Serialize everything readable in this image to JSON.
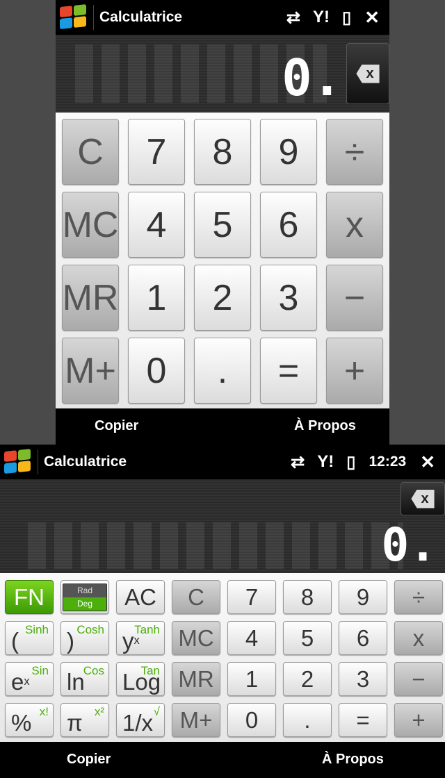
{
  "app_title": "Calculatrice",
  "clock": "12:23",
  "display_value": "0.",
  "backspace_label": "x",
  "menu": {
    "left": "Copier",
    "right": "À Propos"
  },
  "accent": "#4cae0c",
  "basic_keys": [
    {
      "l": "C",
      "t": "g"
    },
    {
      "l": "7"
    },
    {
      "l": "8"
    },
    {
      "l": "9"
    },
    {
      "l": "÷",
      "t": "g"
    },
    {
      "l": "MC",
      "t": "g"
    },
    {
      "l": "4"
    },
    {
      "l": "5"
    },
    {
      "l": "6"
    },
    {
      "l": "x",
      "t": "g"
    },
    {
      "l": "MR",
      "t": "g"
    },
    {
      "l": "1"
    },
    {
      "l": "2"
    },
    {
      "l": "3"
    },
    {
      "l": "−",
      "t": "g"
    },
    {
      "l": "M+",
      "t": "g"
    },
    {
      "l": "0"
    },
    {
      "l": "."
    },
    {
      "l": "="
    },
    {
      "l": "+",
      "t": "g"
    }
  ],
  "sci_keys": [
    {
      "l": "FN",
      "t": "fn"
    },
    {
      "l": "",
      "t": "rd",
      "rad": "Rad",
      "deg": "Deg"
    },
    {
      "l": "AC"
    },
    {
      "l": "C",
      "t": "g"
    },
    {
      "l": "7"
    },
    {
      "l": "8"
    },
    {
      "l": "9"
    },
    {
      "l": "÷",
      "t": "g"
    },
    {
      "l": "(",
      "s": "Sinh"
    },
    {
      "l": ")",
      "s": "Cosh"
    },
    {
      "l": "y",
      "p": "x",
      "s": "Tanh"
    },
    {
      "l": "MC",
      "t": "g"
    },
    {
      "l": "4"
    },
    {
      "l": "5"
    },
    {
      "l": "6"
    },
    {
      "l": "x",
      "t": "g"
    },
    {
      "l": "e",
      "p": "x",
      "s": "Sin"
    },
    {
      "l": "ln",
      "s": "Cos"
    },
    {
      "l": "Log",
      "s": "Tan"
    },
    {
      "l": "MR",
      "t": "g"
    },
    {
      "l": "1"
    },
    {
      "l": "2"
    },
    {
      "l": "3"
    },
    {
      "l": "−",
      "t": "g"
    },
    {
      "l": "%",
      "s": "x!"
    },
    {
      "l": "π",
      "s": "x²"
    },
    {
      "l": "1/x",
      "s": "√"
    },
    {
      "l": "M+",
      "t": "g"
    },
    {
      "l": "0"
    },
    {
      "l": "."
    },
    {
      "l": "="
    },
    {
      "l": "+",
      "t": "g"
    }
  ]
}
